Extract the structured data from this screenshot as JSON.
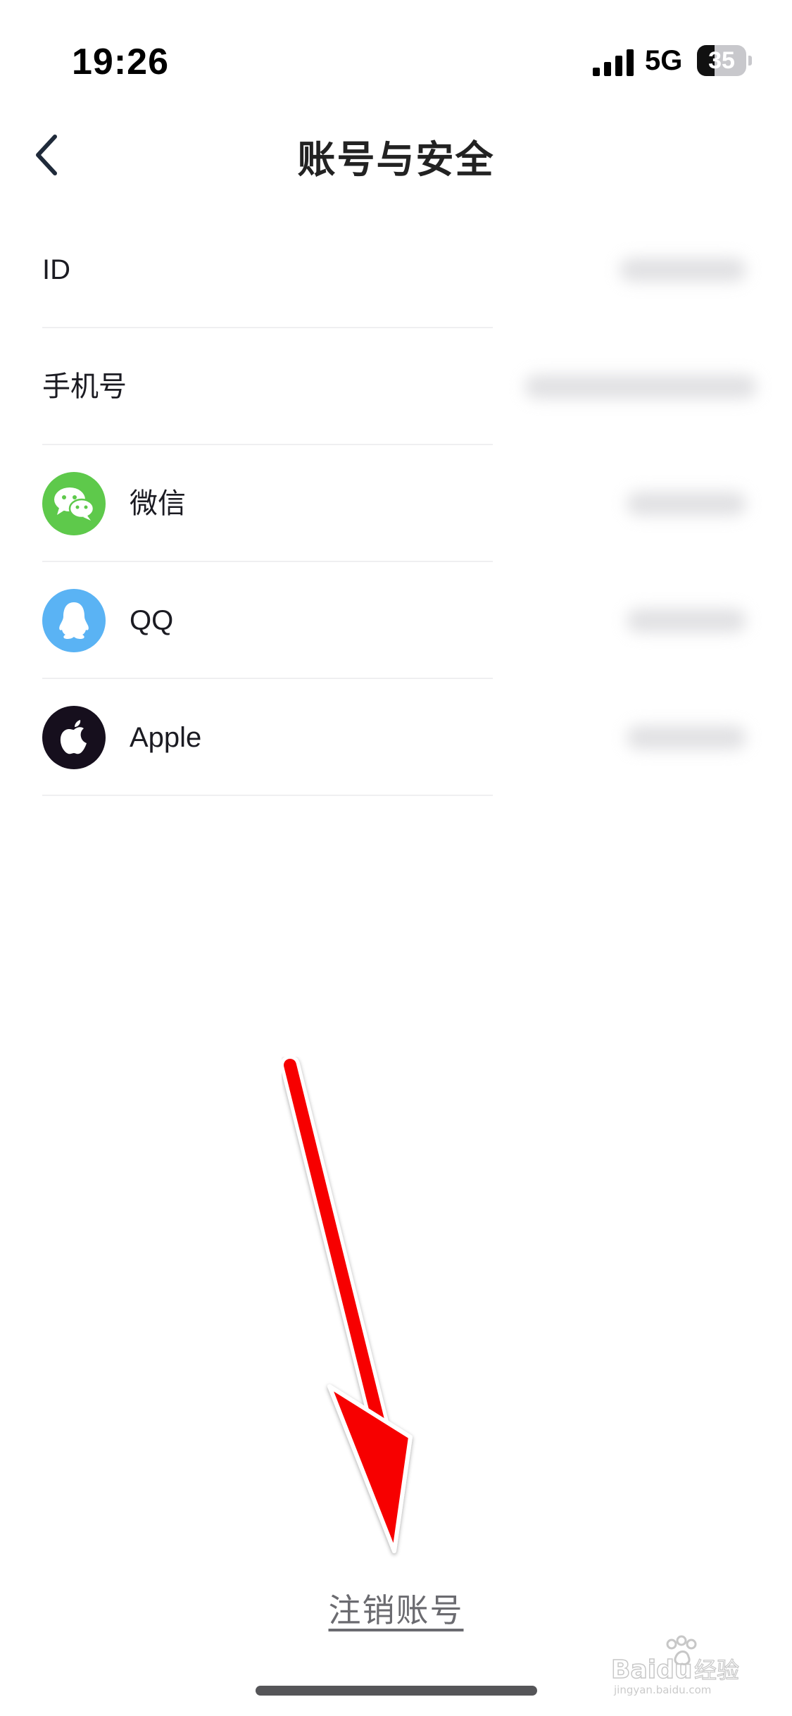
{
  "status_bar": {
    "time": "19:26",
    "network": "5G",
    "battery_level": "35",
    "battery_fraction": 0.35
  },
  "header": {
    "back_icon": "chevron-left-icon",
    "title": "账号与安全"
  },
  "rows": [
    {
      "label": "ID",
      "icon": null
    },
    {
      "label": "手机号",
      "icon": null
    },
    {
      "label": "微信",
      "icon": "wechat-icon",
      "icon_color": "#5ec94b"
    },
    {
      "label": "QQ",
      "icon": "qq-icon",
      "icon_color": "#5ab3f4"
    },
    {
      "label": "Apple",
      "icon": "apple-icon",
      "icon_color": "#160f1d"
    }
  ],
  "footer": {
    "deactivate_label": "注销账号"
  },
  "annotation": {
    "arrow_icon": "red-arrow-down-icon",
    "color": "#f70000"
  },
  "watermark": {
    "text": "Baidu经验",
    "subtext": "jingyan.baidu.com"
  },
  "colors": {
    "text": "#1b1b22",
    "divider": "#efeff1",
    "link": "#6b6b70"
  }
}
